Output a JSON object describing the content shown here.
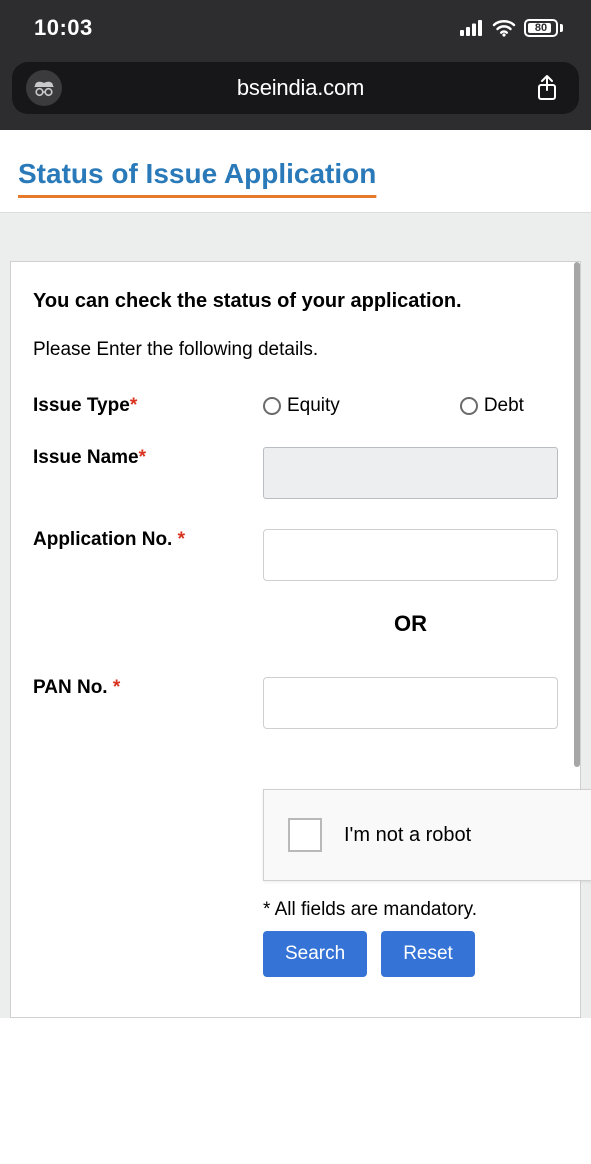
{
  "status": {
    "time": "10:03",
    "battery": 80
  },
  "url": "bseindia.com",
  "page": {
    "title": "Status of Issue Application",
    "lead": "You can check the status of your application.",
    "sub": "Please Enter the following details.",
    "labels": {
      "issue_type": "Issue Type",
      "issue_name": "Issue Name",
      "app_no": "Application No. ",
      "pan_no": "PAN No. "
    },
    "radios": {
      "equity": "Equity",
      "debt": "Debt"
    },
    "or": "OR",
    "captcha": "I'm not a robot",
    "note": "* All fields are mandatory.",
    "buttons": {
      "search": "Search",
      "reset": "Reset"
    }
  }
}
